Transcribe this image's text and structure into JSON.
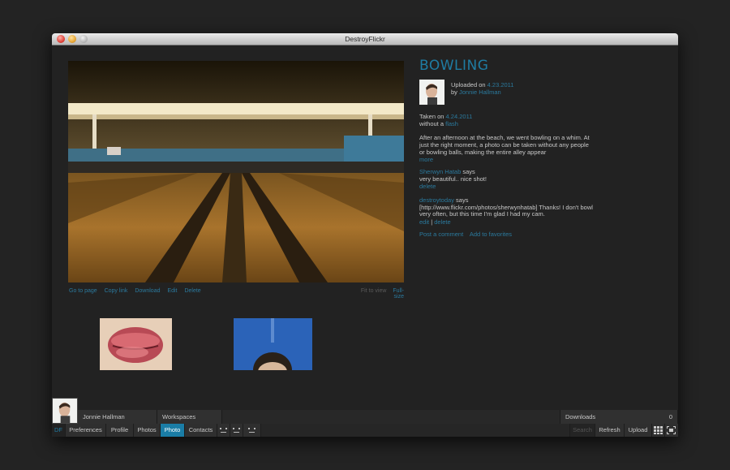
{
  "app": {
    "window_title": "DestroyFlickr"
  },
  "photo": {
    "title": "BOWLING",
    "uploaded_label": "Uploaded on",
    "uploaded_date": "4.23.2011",
    "by_label": "by",
    "uploader": "Jonnie Hallman",
    "taken_label": "Taken on",
    "taken_date": "4.24.2011",
    "without_label": "without a",
    "without_value": "flash",
    "description": "After an afternoon at the beach, we went bowling on a whim. At just the right moment, a photo can be taken without any people or bowling balls, making the entire alley appear",
    "more_label": "more"
  },
  "photo_actions": {
    "go_to_page": "Go to page",
    "copy_link": "Copy link",
    "download": "Download",
    "edit": "Edit",
    "delete": "Delete",
    "fit_to_view": "Fit to view",
    "full_size": "Full-size"
  },
  "comments": [
    {
      "author": "Sherwyn Hatab",
      "says": "says",
      "text": "very beautiful.. nice shot!",
      "delete": "delete"
    },
    {
      "author": "destroytoday",
      "says": "says",
      "text": "[http://www.flickr.com/photos/sherwynhatab] Thanks! I don't bowl very often, but this time I'm glad I had my cam.",
      "edit": "edit",
      "sep": "|",
      "delete": "delete"
    }
  ],
  "comment_actions": {
    "post_comment": "Post a comment",
    "add_favorites": "Add to favorites"
  },
  "status_bar": {
    "user_name": "Jonnie Hallman",
    "workspaces": "Workspaces",
    "downloads_label": "Downloads",
    "downloads_count": "0"
  },
  "nav": {
    "df": "DF",
    "preferences": "Preferences",
    "profile": "Profile",
    "photos": "Photos",
    "photo": "Photo",
    "contacts": "Contacts",
    "search_placeholder": "Search",
    "refresh": "Refresh",
    "upload": "Upload"
  },
  "colors": {
    "accent": "#1f7ca3",
    "background": "#222222",
    "active_tab": "#1a7da6"
  },
  "icons": [
    "face-icon",
    "grid-icon",
    "fullscreen-icon"
  ]
}
